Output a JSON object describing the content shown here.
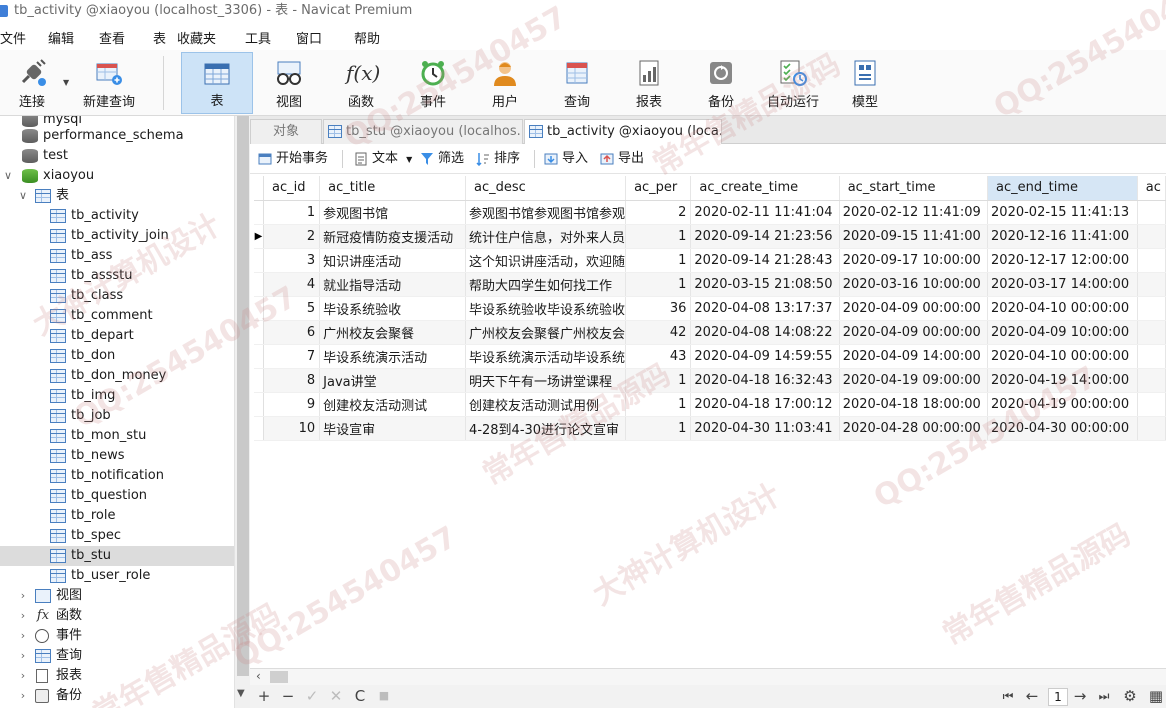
{
  "window": {
    "title": "tb_activity @xiaoyou (localhost_3306) - 表 - Navicat Premium"
  },
  "menu": [
    "文件",
    "编辑",
    "查看",
    "表",
    "收藏夹",
    "工具",
    "窗口",
    "帮助"
  ],
  "toolbar": {
    "connect_label": "连接",
    "new_query_label": "新建查询",
    "table_label": "表",
    "view_label": "视图",
    "function_label": "函数",
    "event_label": "事件",
    "user_label": "用户",
    "query_label": "查询",
    "report_label": "报表",
    "backup_label": "备份",
    "automation_label": "自动运行",
    "model_label": "模型",
    "function_glyph": "f(x)"
  },
  "navigator": {
    "databases": [
      "mysql",
      "performance_schema",
      "test",
      "xiaoyou"
    ],
    "tables_group": "表",
    "tables": [
      "tb_activity",
      "tb_activity_join",
      "tb_ass",
      "tb_assstu",
      "tb_class",
      "tb_comment",
      "tb_depart",
      "tb_don",
      "tb_don_money",
      "tb_img",
      "tb_job",
      "tb_mon_stu",
      "tb_news",
      "tb_notification",
      "tb_question",
      "tb_role",
      "tb_spec",
      "tb_stu",
      "tb_user_role"
    ],
    "selected_table": "tb_stu",
    "groups": [
      "视图",
      "函数",
      "事件",
      "查询",
      "报表",
      "备份"
    ],
    "function_glyph": "fx"
  },
  "tabs": [
    "对象",
    "tb_stu @xiaoyou (localhos...",
    "tb_activity @xiaoyou (loca..."
  ],
  "subtoolbar": {
    "begin_transaction": "开始事务",
    "text": "文本",
    "filter": "筛选",
    "sort": "排序",
    "import": "导入",
    "export": "导出"
  },
  "grid": {
    "columns": [
      "ac_id",
      "ac_title",
      "ac_desc",
      "ac_per",
      "ac_create_time",
      "ac_start_time",
      "ac_end_time",
      "ac"
    ],
    "sorted_column": "ac_end_time",
    "current_row": 2,
    "rows": [
      [
        "1",
        "参观图书馆",
        "参观图书馆参观图书馆参观",
        "2",
        "2020-02-11 11:41:04",
        "2020-02-12 11:41:09",
        "2020-02-15 11:41:13"
      ],
      [
        "2",
        "新冠疫情防疫支援活动",
        "统计住户信息，对外来人员",
        "1",
        "2020-09-14 21:23:56",
        "2020-09-15 11:41:00",
        "2020-12-16 11:41:00"
      ],
      [
        "3",
        "知识讲座活动",
        "这个知识讲座活动，欢迎随",
        "1",
        "2020-09-14 21:28:43",
        "2020-09-17 10:00:00",
        "2020-12-17 12:00:00"
      ],
      [
        "4",
        "就业指导活动",
        "帮助大四学生如何找工作",
        "1",
        "2020-03-15 21:08:50",
        "2020-03-16 10:00:00",
        "2020-03-17 14:00:00"
      ],
      [
        "5",
        "毕设系统验收",
        "毕设系统验收毕设系统验收",
        "36",
        "2020-04-08 13:17:37",
        "2020-04-09 00:00:00",
        "2020-04-10 00:00:00"
      ],
      [
        "6",
        "广州校友会聚餐",
        "广州校友会聚餐广州校友会",
        "42",
        "2020-04-08 14:08:22",
        "2020-04-09 00:00:00",
        "2020-04-09 10:00:00"
      ],
      [
        "7",
        "毕设系统演示活动",
        "毕设系统演示活动毕设系统",
        "43",
        "2020-04-09 14:59:55",
        "2020-04-09 14:00:00",
        "2020-04-10 00:00:00"
      ],
      [
        "8",
        "Java讲堂",
        "明天下午有一场讲堂课程",
        "1",
        "2020-04-18 16:32:43",
        "2020-04-19 09:00:00",
        "2020-04-19 14:00:00"
      ],
      [
        "9",
        "创建校友活动测试",
        "创建校友活动测试用例",
        "1",
        "2020-04-18 17:00:12",
        "2020-04-18 18:00:00",
        "2020-04-19 00:00:00"
      ],
      [
        "10",
        "毕设宣审",
        "4-28到4-30进行论文宣审",
        "1",
        "2020-04-30 11:03:41",
        "2020-04-28 00:00:00",
        "2020-04-30 00:00:00"
      ]
    ]
  },
  "statusbar": {
    "add": "+",
    "remove": "−",
    "apply": "✓",
    "discard": "✕",
    "refresh": "C",
    "stop": "■",
    "first": "⏮",
    "prev": "←",
    "page": "1",
    "next": "→",
    "last": "⏭",
    "settings": "⚙",
    "grid_view": "▦"
  },
  "watermarks": [
    "QQ:254540457",
    "常年售精品源码",
    "大神计算机设计"
  ]
}
